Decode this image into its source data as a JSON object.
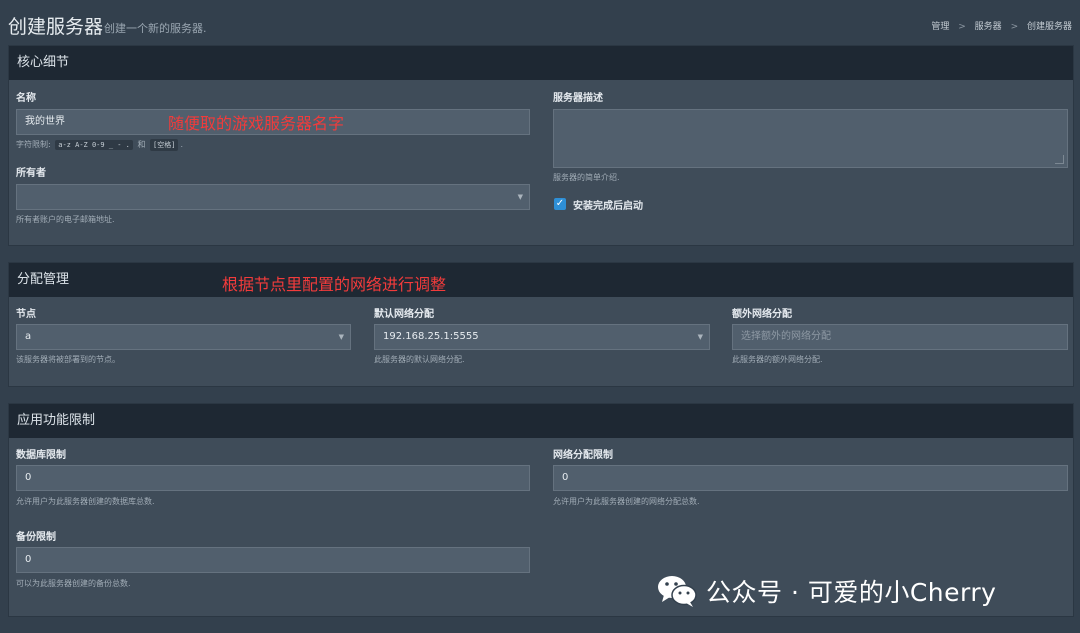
{
  "header": {
    "title": "创建服务器",
    "subtitle": "创建一个新的服务器.",
    "breadcrumb": [
      "管理",
      "服务器",
      "创建服务器"
    ],
    "breadcrumb_sep": ">"
  },
  "core": {
    "title": "核心细节",
    "name_label": "名称",
    "name_value": "我的世界",
    "name_help_prefix": "字符限制:",
    "name_help_code1": "a-z A-Z 0-9 _ - .",
    "name_help_and": "和",
    "name_help_code2": "[空格]",
    "name_help_suffix": ".",
    "owner_label": "所有者",
    "owner_value": "",
    "owner_help": "所有者账户的电子邮箱地址.",
    "desc_label": "服务器描述",
    "desc_value": "",
    "desc_help": "服务器的简单介绍.",
    "start_label": "安装完成后启动",
    "start_checked": true
  },
  "allocation": {
    "title": "分配管理",
    "node_label": "节点",
    "node_value": "a",
    "node_help": "该服务器将被部署到的节点。",
    "default_label": "默认网络分配",
    "default_value": "192.168.25.1:5555",
    "default_help": "此服务器的默认网络分配.",
    "extra_label": "额外网络分配",
    "extra_placeholder": "选择额外的网络分配",
    "extra_help": "此服务器的额外网络分配."
  },
  "limits": {
    "title": "应用功能限制",
    "db_label": "数据库限制",
    "db_value": "0",
    "db_help": "允许用户为此服务器创建的数据库总数.",
    "alloc_label": "网络分配限制",
    "alloc_value": "0",
    "alloc_help": "允许用户为此服务器创建的网络分配总数.",
    "backup_label": "备份限制",
    "backup_value": "0",
    "backup_help": "可以为此服务器创建的备份总数."
  },
  "annotations": {
    "name_note": "随便取的游戏服务器名字",
    "alloc_note": "根据节点里配置的网络进行调整"
  },
  "watermark": {
    "text": "公众号 · 可爱的小Cherry",
    "icon": "wechat-icon"
  },
  "colors": {
    "header_bar": "#1e2833",
    "panel": "#3f4c59",
    "background": "#33404d",
    "annotation": "#f23b3b",
    "checkbox": "#2e8fd6"
  }
}
